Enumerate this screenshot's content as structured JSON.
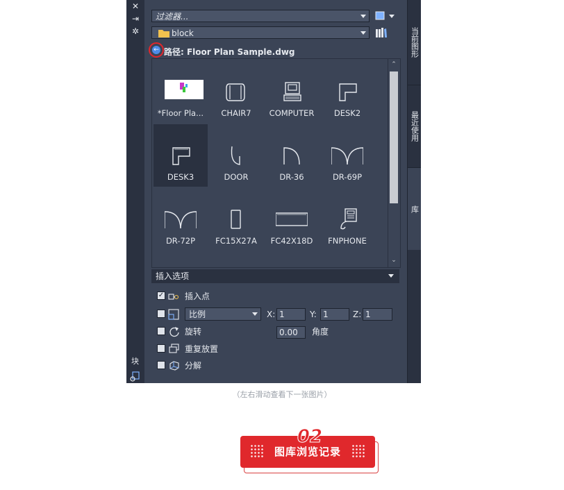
{
  "left_toolbar": {
    "icons": [
      "close-icon",
      "pin-icon",
      "settings-icon"
    ],
    "bottom_label": "块"
  },
  "right_tabs": [
    {
      "label": "当前图形"
    },
    {
      "label": "最近使用"
    },
    {
      "label": "库"
    }
  ],
  "filter": {
    "placeholder": "过滤器..."
  },
  "folder": {
    "value": "block"
  },
  "path": {
    "text": "路径: Floor Plan Sample.dwg"
  },
  "blocks": [
    {
      "label": "*Floor Pla...",
      "icon": "floor-plan-thumbnail"
    },
    {
      "label": "CHAIR7",
      "icon": "chair-icon"
    },
    {
      "label": "COMPUTER",
      "icon": "computer-icon"
    },
    {
      "label": "DESK2",
      "icon": "desk2-icon"
    },
    {
      "label": "DESK3",
      "icon": "desk3-icon",
      "selected": true
    },
    {
      "label": "DOOR",
      "icon": "door-icon"
    },
    {
      "label": "DR-36",
      "icon": "dr36-icon"
    },
    {
      "label": "DR-69P",
      "icon": "dr69p-icon"
    },
    {
      "label": "DR-72P",
      "icon": "dr72p-icon"
    },
    {
      "label": "FC15X27A",
      "icon": "fc15x27a-icon"
    },
    {
      "label": "FC42X18D",
      "icon": "fc42x18d-icon"
    },
    {
      "label": "FNPHONE",
      "icon": "phone-icon"
    }
  ],
  "insert_options": {
    "header": "插入选项",
    "insertion_point": {
      "label": "插入点",
      "checked": true
    },
    "scale": {
      "checked": false,
      "mode": "比例",
      "x_label": "X:",
      "x": "1",
      "y_label": "Y:",
      "y": "1",
      "z_label": "Z:",
      "z": "1"
    },
    "rotation": {
      "label": "旋转",
      "checked": false,
      "value": "0.00",
      "angle_label": "角度"
    },
    "repeat": {
      "label": "重复放置",
      "checked": false
    },
    "explode": {
      "label": "分解",
      "checked": false
    }
  },
  "caption": "（左右滑动查看下一张图片）",
  "badge": {
    "number": "02",
    "text": "图库浏览记录"
  }
}
